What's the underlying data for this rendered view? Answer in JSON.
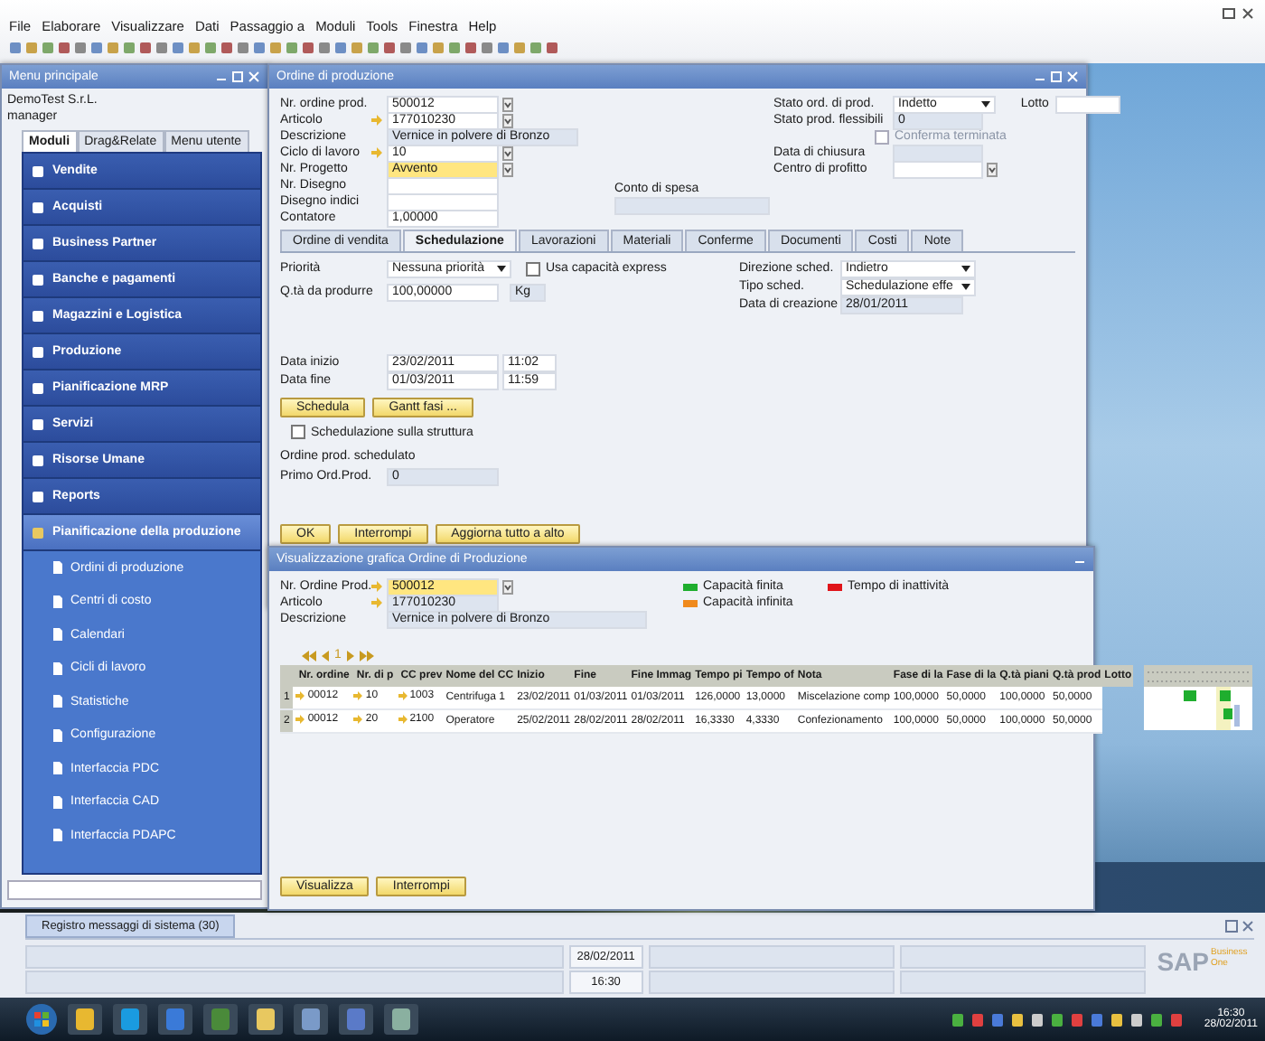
{
  "menu_bar": [
    "File",
    "Elaborare",
    "Visualizzare",
    "Dati",
    "Passaggio a",
    "Moduli",
    "Tools",
    "Finestra",
    "Help"
  ],
  "main_menu": {
    "title": "Menu principale",
    "company": "DemoTest S.r.L.",
    "user": "manager",
    "tabs": [
      {
        "label": "Moduli",
        "selected": true
      },
      {
        "label": "Drag&Relate",
        "selected": false
      },
      {
        "label": "Menu utente",
        "selected": false
      }
    ],
    "items": [
      {
        "label": "Vendite",
        "expanded": false
      },
      {
        "label": "Acquisti",
        "expanded": false
      },
      {
        "label": "Business Partner",
        "expanded": false
      },
      {
        "label": "Banche e pagamenti",
        "expanded": false
      },
      {
        "label": "Magazzini e Logistica",
        "expanded": false
      },
      {
        "label": "Produzione",
        "expanded": false
      },
      {
        "label": "Pianificazione MRP",
        "expanded": false
      },
      {
        "label": "Servizi",
        "expanded": false
      },
      {
        "label": "Risorse Umane",
        "expanded": false
      },
      {
        "label": "Reports",
        "expanded": false
      },
      {
        "label": "Pianificazione della produzione",
        "expanded": true,
        "children": [
          {
            "label": "Ordini di produzione"
          },
          {
            "label": "Centri di costo"
          },
          {
            "label": "Calendari"
          },
          {
            "label": "Cicli di lavoro"
          },
          {
            "label": "Statistiche"
          },
          {
            "label": "Configurazione"
          },
          {
            "label": "Interfaccia PDC"
          },
          {
            "label": "Interfaccia CAD"
          },
          {
            "label": "Interfaccia PDAPC"
          }
        ]
      }
    ]
  },
  "production_order": {
    "title": "Ordine di produzione",
    "fields_left": [
      {
        "label": "Nr. ordine prod.",
        "value": "500012",
        "kind": "lookup",
        "link": false
      },
      {
        "label": "Articolo",
        "value": "177010230",
        "kind": "lookup",
        "link": true
      },
      {
        "label": "Descrizione",
        "value": "Vernice in polvere di Bronzo",
        "kind": "readonly",
        "link": false
      },
      {
        "label": "Ciclo di lavoro",
        "value": "10",
        "kind": "lookup",
        "link": true
      },
      {
        "label": "Nr. Progetto",
        "value": "Avvento",
        "kind": "active",
        "link": false
      },
      {
        "label": "Nr. Disegno",
        "kind": "input",
        "link": false
      },
      {
        "label": "Disegno indici",
        "kind": "input",
        "link": false
      },
      {
        "label": "Contatore",
        "value": "1,00000",
        "kind": "input",
        "link": false
      }
    ],
    "expense_account": {
      "label": "Conto di spesa"
    },
    "fields_right": [
      {
        "label": "Stato ord. di prod.",
        "value": "Indetto",
        "kind": "dropdown"
      },
      {
        "label": "Stato prod. flessibili",
        "value": "0",
        "kind": "readonly"
      },
      {
        "label": "Conferma terminata",
        "kind": "checkbox",
        "checked": false,
        "disabled": true
      },
      {
        "label": "Data di chiusura",
        "kind": "readonly"
      },
      {
        "label": "Centro di profitto",
        "kind": "lookup"
      }
    ],
    "lot": {
      "label": "Lotto"
    },
    "tabs": [
      {
        "label": "Ordine di vendita",
        "selected": false
      },
      {
        "label": "Schedulazione",
        "selected": true
      },
      {
        "label": "Lavorazioni",
        "selected": false
      },
      {
        "label": "Materiali",
        "selected": false
      },
      {
        "label": "Conferme",
        "selected": false
      },
      {
        "label": "Documenti",
        "selected": false
      },
      {
        "label": "Costi",
        "selected": false
      },
      {
        "label": "Note",
        "selected": false
      }
    ],
    "schedule": {
      "priority": {
        "label": "Priorità",
        "value": "Nessuna priorità"
      },
      "express": {
        "label": "Usa capacità express",
        "checked": false
      },
      "quantity": {
        "label": "Q.tà da produrre",
        "value": "100,00000",
        "unit": "Kg"
      },
      "dates": [
        {
          "label": "Data inizio",
          "date": "23/02/2011",
          "time": "11:02"
        },
        {
          "label": "Data fine",
          "date": "01/03/2011",
          "time": "11:59"
        }
      ],
      "buttons": [
        "Schedula",
        "Gantt fasi ..."
      ],
      "structure": {
        "label": "Schedulazione sulla struttura",
        "checked": false
      },
      "scheduled_heading": "Ordine prod. schedulato",
      "first_order": {
        "label": "Primo Ord.Prod.",
        "value": "0"
      },
      "fields_right": [
        {
          "label": "Direzione sched.",
          "value": "Indietro",
          "kind": "dropdown"
        },
        {
          "label": "Tipo sched.",
          "value": "Schedulazione effe",
          "kind": "dropdown"
        },
        {
          "label": "Data di creazione",
          "value": "28/01/2011",
          "kind": "readonly"
        }
      ]
    },
    "buttons": [
      "OK",
      "Interrompi",
      "Aggiorna tutto a alto"
    ]
  },
  "gantt_window": {
    "title": "Visualizzazione grafica Ordine di Produzione",
    "fields": [
      {
        "label": "Nr. Ordine Prod.",
        "value": "500012",
        "kind": "active",
        "link": true
      },
      {
        "label": "Articolo",
        "value": "177010230",
        "kind": "readonly",
        "link": true
      },
      {
        "label": "Descrizione",
        "value": "Vernice in polvere di Bronzo",
        "kind": "readonly",
        "link": false
      }
    ],
    "legend": [
      {
        "label": "Capacità finita",
        "color": "#1fae2e"
      },
      {
        "label": "Capacità infinita",
        "color": "#f08a1c"
      },
      {
        "label": "Tempo di inattività",
        "color": "#e0141a"
      }
    ],
    "page": "1",
    "table": {
      "columns": [
        {
          "label": "Nr. ordine",
          "kind": "link"
        },
        {
          "label": "Nr. di p",
          "kind": "link"
        },
        {
          "label": "CC prev",
          "kind": "link"
        },
        {
          "label": "Nome del CC",
          "kind": "text"
        },
        {
          "label": "Inizio",
          "kind": "text"
        },
        {
          "label": "Fine",
          "kind": "text"
        },
        {
          "label": "Fine Immag",
          "kind": "text"
        },
        {
          "label": "Tempo pi",
          "kind": "text"
        },
        {
          "label": "Tempo of",
          "kind": "text"
        },
        {
          "label": "Nota",
          "kind": "text"
        },
        {
          "label": "Fase di la",
          "kind": "text"
        },
        {
          "label": "Fase di la",
          "kind": "text"
        },
        {
          "label": "Q.tà piani",
          "kind": "text"
        },
        {
          "label": "Q.tà prod",
          "kind": "text"
        },
        {
          "label": "Lotto",
          "kind": "text"
        }
      ],
      "rows": [
        {
          "number": "1",
          "cells": [
            "00012",
            "10",
            "1003",
            "Centrifuga 1",
            "23/02/2011",
            "01/03/2011",
            "01/03/2011",
            "126,0000",
            "13,0000",
            "Miscelazione comp",
            "100,0000",
            "50,0000",
            "100,0000",
            "50,0000"
          ]
        },
        {
          "number": "2",
          "cells": [
            "00012",
            "20",
            "2100",
            "Operatore",
            "25/02/2011",
            "28/02/2011",
            "28/02/2011",
            "16,3330",
            "4,3330",
            "Confezionamento",
            "100,0000",
            "50,0000",
            "100,0000",
            "50,0000"
          ]
        }
      ]
    },
    "buttons": [
      "Visualizza",
      "Interrompi"
    ]
  },
  "message_log": {
    "tab": "Registro messaggi di sistema (30)"
  },
  "status_bar": {
    "date": "28/02/2011",
    "time": "16:30"
  },
  "logo": {
    "brand": "SAP",
    "product": "Business One"
  },
  "taskbar": {
    "time": "16:30",
    "date": "28/02/2011"
  }
}
